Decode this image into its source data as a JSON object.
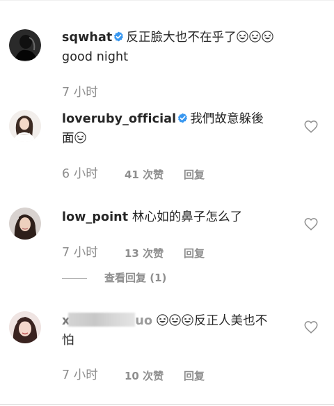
{
  "comments": [
    {
      "username": "sqwhat",
      "verified": true,
      "text_before_emoji": "反正臉大也不在乎了",
      "emoji_count": 3,
      "text_line2": "good night",
      "time": "7 小时",
      "likes": "",
      "reply_label": ""
    },
    {
      "username": "loveruby_official",
      "verified": true,
      "text": "我們故意躲後",
      "text_line2": "面",
      "emoji_count": 1,
      "time": "6 小时",
      "likes": "41 次赞",
      "reply_label": "回复"
    },
    {
      "username": "low_point",
      "verified": false,
      "text": "林心如的鼻子怎么了",
      "time": "7 小时",
      "likes": "13 次赞",
      "reply_label": "回复",
      "view_replies": "查看回复 (1)"
    },
    {
      "username_prefix": "x",
      "username_suffix": "uo",
      "verified": false,
      "emoji_count": 3,
      "text": "反正人美也不",
      "text_line2": "怕",
      "time": "7 小时",
      "likes": "10 次赞",
      "reply_label": "回复"
    }
  ],
  "icons": {
    "verified": "verified-badge-icon",
    "like": "heart-outline-icon",
    "emoji": "grinning-squinting-face-icon"
  },
  "colors": {
    "verified_blue": "#3897f0",
    "secondary_text": "#8e8e8e",
    "primary_text": "#262626"
  }
}
